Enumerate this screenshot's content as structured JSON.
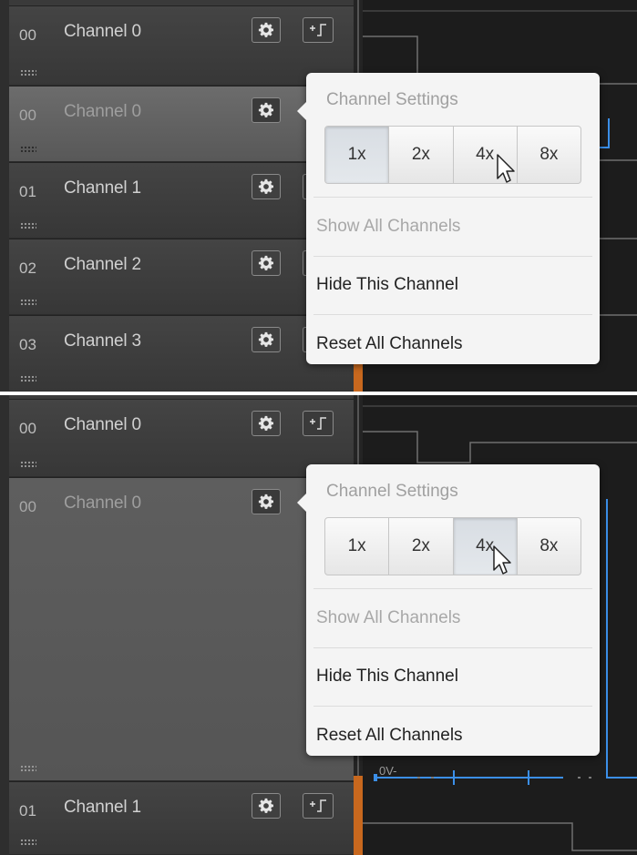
{
  "panels": [
    {
      "rows": [
        {
          "num": "00",
          "name": "Channel 0"
        },
        {
          "num": "00",
          "name": "Channel 0",
          "active": true
        },
        {
          "num": "01",
          "name": "Channel 1"
        },
        {
          "num": "02",
          "name": "Channel 2"
        },
        {
          "num": "03",
          "name": "Channel 3"
        }
      ],
      "popup": {
        "title": "Channel Settings",
        "options": [
          "1x",
          "2x",
          "4x",
          "8x"
        ],
        "selected": "1x",
        "hovered": "4x",
        "items": [
          {
            "label": "Show All Channels",
            "enabled": false
          },
          {
            "label": "Hide This Channel",
            "enabled": true
          },
          {
            "label": "Reset All Channels",
            "enabled": true
          }
        ]
      }
    },
    {
      "rows": [
        {
          "num": "00",
          "name": "Channel 0"
        },
        {
          "num": "00",
          "name": "Channel 0",
          "active": true
        },
        {
          "num": "01",
          "name": "Channel 1"
        }
      ],
      "popup": {
        "title": "Channel Settings",
        "options": [
          "1x",
          "2x",
          "4x",
          "8x"
        ],
        "selected": "4x",
        "hovered": "4x",
        "items": [
          {
            "label": "Show All Channels",
            "enabled": false
          },
          {
            "label": "Hide This Channel",
            "enabled": true
          },
          {
            "label": "Reset All Channels",
            "enabled": true
          }
        ]
      },
      "analog_label": "0V-"
    }
  ],
  "icons": {
    "settings": "gear-icon",
    "trigger": "trigger-edge-icon",
    "grip": "drag-handle-icon",
    "cursor": "mouse-pointer-icon"
  },
  "colors": {
    "signal": "#3b8fe8",
    "wave_line": "#7a7a7a",
    "divider_accent": "#c8681e",
    "popup_bg": "#f4f4f4"
  }
}
